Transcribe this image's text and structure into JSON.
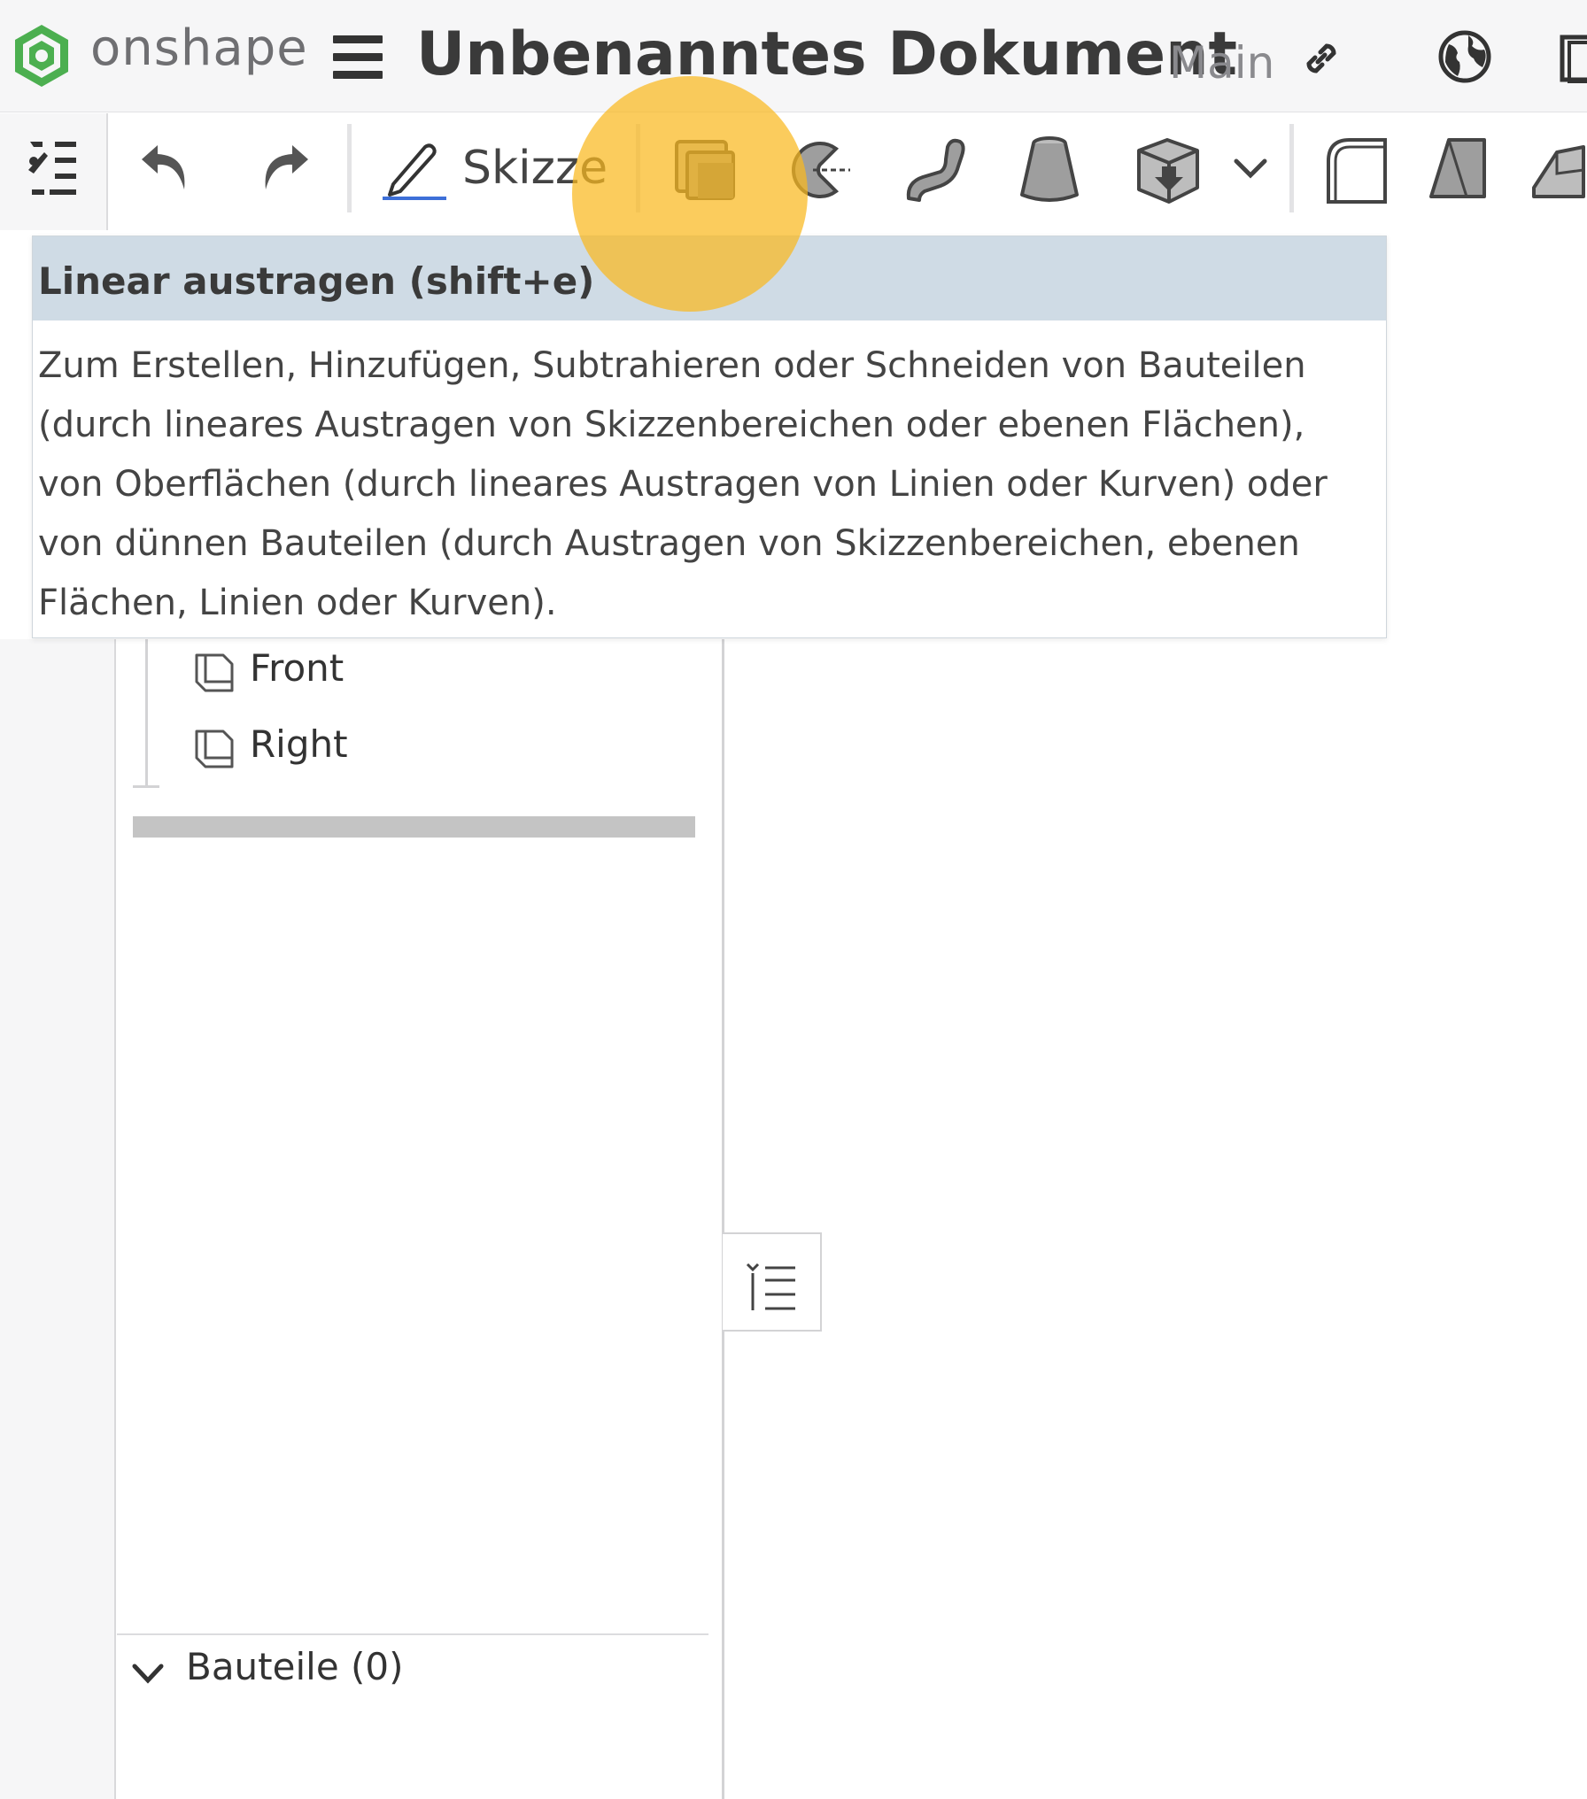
{
  "header": {
    "logo_text": "onshape",
    "document_title": "Unbenanntes Dokument",
    "branch": "Main"
  },
  "toolbar": {
    "sketch_label": "Skizze",
    "accent_color": "#3d6fd8"
  },
  "tooltip": {
    "title": "Linear austragen (shift+e)",
    "lines": [
      "Zum Erstellen, Hinzufügen, Subtrahieren oder Schneiden von Bauteilen",
      "(durch lineares Austragen von Skizzenbereichen oder ebenen Flächen),",
      "von Oberflächen (durch lineares Austragen von Linien oder Kurven) oder",
      "von dünnen Bauteilen (durch Austragen von Skizzenbereichen, ebenen",
      "Flächen, Linien oder Kurven)."
    ]
  },
  "feature_tree": {
    "planes": [
      "Front",
      "Right"
    ]
  },
  "parts": {
    "label": "Bauteile (0)"
  },
  "colors": {
    "highlight": "#fab91e",
    "logo_green": "#4caf50",
    "tooltip_header": "#cfdbe5"
  }
}
